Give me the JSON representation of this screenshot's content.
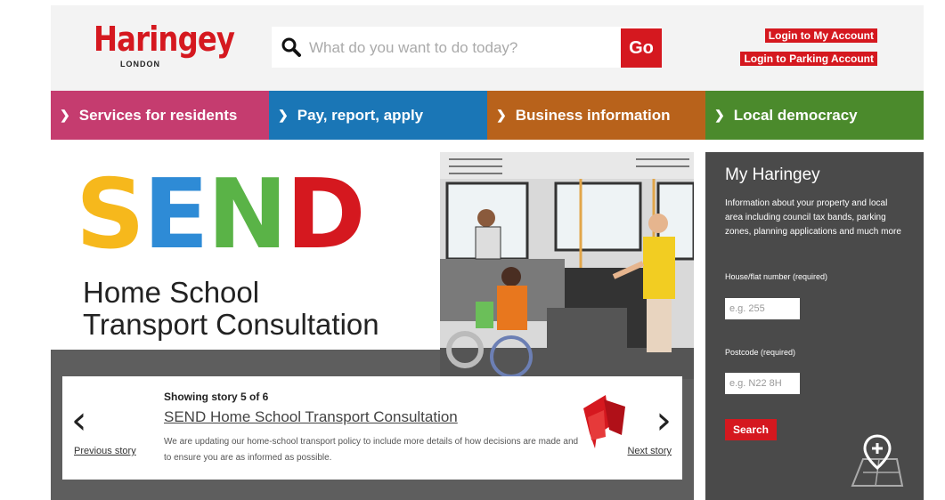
{
  "header": {
    "logo_text": "Haringey",
    "logo_subtext": "LONDON",
    "search_placeholder": "What do you want to do today?",
    "go_label": "Go",
    "login_links": [
      "Login to My Account",
      "Login to Parking Account"
    ]
  },
  "nav": [
    {
      "label": "Services for residents",
      "color": "#c53c6f"
    },
    {
      "label": "Pay, report, apply",
      "color": "#1a76b6"
    },
    {
      "label": "Business information",
      "color": "#b8621b"
    },
    {
      "label": "Local democracy",
      "color": "#4b8a2c"
    }
  ],
  "hero": {
    "send_letters": [
      {
        "char": "S",
        "color": "#f6b81c"
      },
      {
        "char": "E",
        "color": "#2e8bd6"
      },
      {
        "char": "N",
        "color": "#5ab347"
      },
      {
        "char": "D",
        "color": "#d5181f"
      }
    ],
    "subtitle_line1": "Home School",
    "subtitle_line2": "Transport Consultation"
  },
  "story": {
    "count": "Showing story 5 of 6",
    "title": "SEND Home School Transport Consultation",
    "description": "We are updating our home-school transport policy to include more details of how decisions are made and to ensure you are as informed as possible.",
    "prev_label": "Previous story",
    "next_label": "Next story"
  },
  "sidebar": {
    "title": "My Haringey",
    "description": "Information about your property and local area including council tax bands, parking zones, planning applications and much more",
    "house_label": "House/flat number (required)",
    "house_placeholder": "e.g. 255",
    "postcode_label": "Postcode (required)",
    "postcode_placeholder": "e.g. N22 8H",
    "search_label": "Search"
  },
  "colors": {
    "brand_red": "#d5181f",
    "sidebar_bg": "#4a4a4a",
    "hero_bg": "#5e5e5e"
  }
}
